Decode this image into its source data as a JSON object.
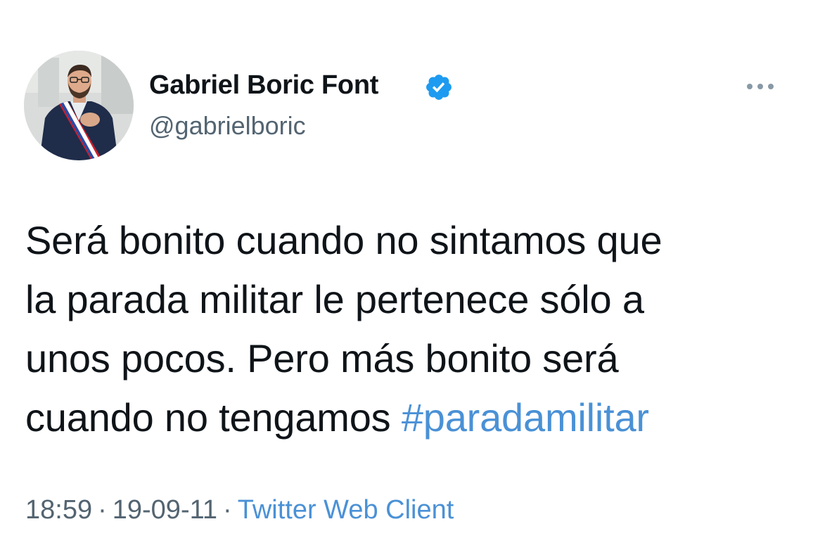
{
  "tweet": {
    "display_name": "Gabriel Boric Font",
    "handle": "@gabrielboric",
    "verified": true,
    "body_lines": [
      "Será bonito cuando no sintamos que",
      "la parada militar le pertenece sólo a",
      "unos pocos. Pero más bonito será",
      "cuando no tengamos "
    ],
    "hashtag": "#paradamilitar",
    "time": "18:59",
    "separator": "·",
    "date": "19-09-11",
    "source": "Twitter Web Client"
  },
  "icons": {
    "verified": "verified-badge-icon",
    "more": "more-options-icon"
  },
  "colors": {
    "text": "#0f1419",
    "secondary": "#536471",
    "link": "#4a91d6",
    "verified": "#1d9bf0"
  }
}
